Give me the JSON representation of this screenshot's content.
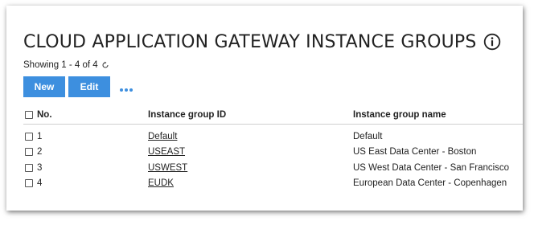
{
  "page": {
    "title": "CLOUD APPLICATION GATEWAY INSTANCE GROUPS",
    "info_icon": "info-circle-icon",
    "showing_text": "Showing 1 - 4 of 4",
    "refresh_icon": "refresh-icon"
  },
  "toolbar": {
    "new_label": "New",
    "edit_label": "Edit",
    "more_icon": "more-horizontal-icon",
    "accent_color": "#3d8fdf"
  },
  "table": {
    "headers": {
      "no": "No.",
      "id": "Instance group ID",
      "name": "Instance group name"
    },
    "rows": [
      {
        "no": "1",
        "id": "Default",
        "name": "Default"
      },
      {
        "no": "2",
        "id": "USEAST",
        "name": "US East Data Center - Boston"
      },
      {
        "no": "3",
        "id": "USWEST",
        "name": "US West Data Center - San Francisco"
      },
      {
        "no": "4",
        "id": "EUDK",
        "name": "European Data Center - Copenhagen"
      }
    ]
  }
}
